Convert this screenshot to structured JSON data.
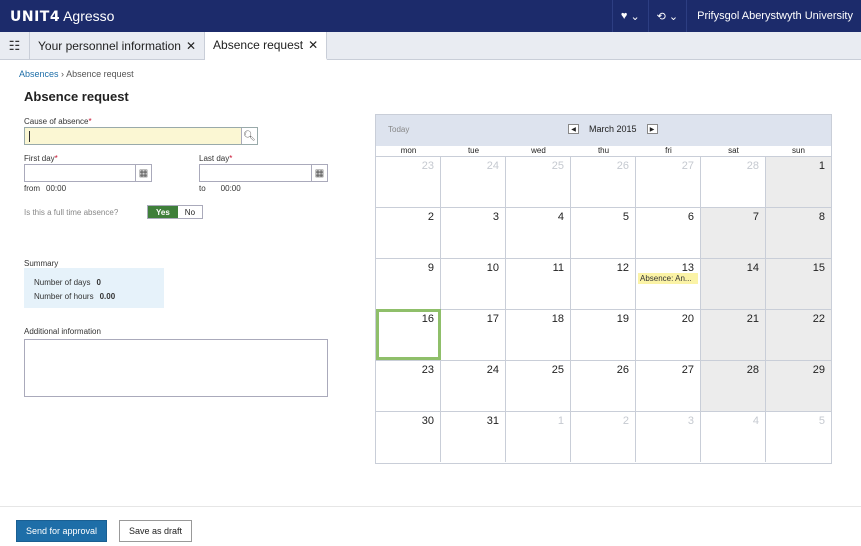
{
  "app": {
    "brand": "UNIT4",
    "product": "Agresso",
    "user_org": "Prifysgol Aberystwyth University",
    "icons": [
      "heart-icon",
      "history-icon"
    ]
  },
  "tabs": [
    {
      "label": "Your personnel information",
      "close": "✕"
    },
    {
      "label": "Absence request",
      "close": "✕"
    }
  ],
  "breadcrumb": {
    "parent": "Absences",
    "separator": "›",
    "current": "Absence request"
  },
  "page": {
    "title": "Absence request"
  },
  "form": {
    "cause_label": "Cause of absence",
    "cause_value": "",
    "required_mark": "*",
    "first_day_label": "First day",
    "last_day_label": "Last day",
    "from_label": "from",
    "from_value": "00:00",
    "to_label": "to",
    "to_value": "00:00",
    "full_time_label": "Is this a full time absence?",
    "yes_label": "Yes",
    "no_label": "No",
    "summary_label": "Summary",
    "days_label": "Number of days",
    "days_value": "0",
    "hours_label": "Number of hours",
    "hours_value": "0.00",
    "additional_label": "Additional information"
  },
  "calendar": {
    "today_label": "Today",
    "month_label": "March 2015",
    "weekdays": [
      "mon",
      "tue",
      "wed",
      "thu",
      "fri",
      "sat",
      "sun"
    ],
    "days": [
      "23",
      "24",
      "25",
      "26",
      "27",
      "28",
      "1",
      "2",
      "3",
      "4",
      "5",
      "6",
      "7",
      "8",
      "9",
      "10",
      "11",
      "12",
      "13",
      "14",
      "15",
      "16",
      "17",
      "18",
      "19",
      "20",
      "21",
      "22",
      "23",
      "24",
      "25",
      "26",
      "27",
      "28",
      "29",
      "30",
      "31",
      "1",
      "2",
      "3",
      "4",
      "5"
    ],
    "event": {
      "day": "13",
      "label": "Absence: An..."
    }
  },
  "footer": {
    "primary_label": "Send for approval",
    "secondary_label": "Save as draft"
  },
  "colors": {
    "topbar": "#1c2b6b",
    "accent": "#1e6ea8",
    "toggle_on": "#3f7f3a",
    "event": "#fbf3a6",
    "today": "#8fbf6a"
  }
}
